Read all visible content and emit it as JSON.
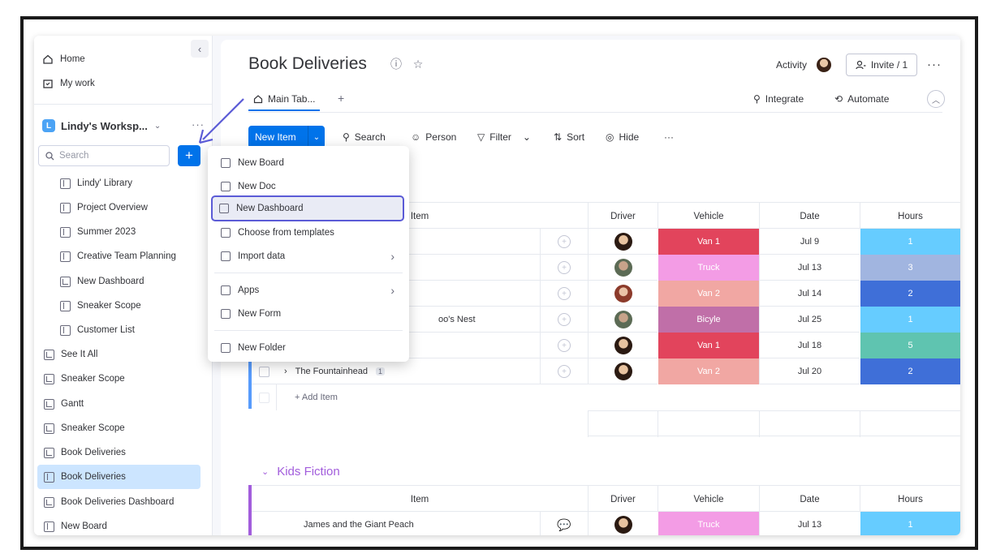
{
  "sidebar": {
    "collapse_icon": "chevron-left-icon",
    "nav": [
      {
        "label": "Home",
        "icon": "home-icon"
      },
      {
        "label": "My work",
        "icon": "calendar-icon"
      }
    ],
    "workspace": {
      "badge": "L",
      "name": "Lindy's Worksp...",
      "badge_color": "#4ba3f5"
    },
    "search_placeholder": "Search",
    "add_button_label": "+",
    "items": [
      {
        "label": "Lindy' Library"
      },
      {
        "label": "Project Overview"
      },
      {
        "label": "Summer 2023"
      },
      {
        "label": "Creative Team Planning"
      },
      {
        "label": "New Dashboard"
      },
      {
        "label": "Sneaker Scope"
      },
      {
        "label": "Customer List"
      },
      {
        "label": "See It All"
      },
      {
        "label": "Sneaker Scope"
      },
      {
        "label": "Gantt"
      },
      {
        "label": "Sneaker Scope"
      },
      {
        "label": "Book Deliveries"
      },
      {
        "label": "Book Deliveries",
        "selected": true
      },
      {
        "label": "Book Deliveries Dashboard"
      },
      {
        "label": "New Board"
      }
    ]
  },
  "header": {
    "title": "Book Deliveries",
    "activity_label": "Activity",
    "invite_label": "Invite / 1",
    "tab_main": "Main Tab...",
    "tab_add": "+",
    "integrate_label": "Integrate",
    "automate_label": "Automate"
  },
  "toolbar": {
    "new_item": "New Item",
    "search": "Search",
    "person": "Person",
    "filter": "Filter",
    "sort": "Sort",
    "hide": "Hide"
  },
  "table": {
    "columns": [
      "Item",
      "Driver",
      "Vehicle",
      "Date",
      "Hours"
    ],
    "rows": [
      {
        "item": "",
        "vehicle": "Van 1",
        "vehicle_color": "#e2445c",
        "date": "Jul 9",
        "hours": "1",
        "hours_color": "#66ccff",
        "avatar": "d"
      },
      {
        "item": "",
        "vehicle": "Truck",
        "vehicle_color": "#f39ce5",
        "date": "Jul 13",
        "hours": "3",
        "hours_color": "#a1b5e0",
        "avatar": "g"
      },
      {
        "item": "",
        "vehicle": "Van 2",
        "vehicle_color": "#f1a7a3",
        "date": "Jul 14",
        "hours": "2",
        "hours_color": "#3f6fd8",
        "avatar": "r"
      },
      {
        "item": "oo's Nest",
        "vehicle": "Bicyle",
        "vehicle_color": "#c06fa8",
        "date": "Jul 25",
        "hours": "1",
        "hours_color": "#66ccff",
        "avatar": "g"
      },
      {
        "item": "",
        "vehicle": "Van 1",
        "vehicle_color": "#e2445c",
        "date": "Jul 18",
        "hours": "5",
        "hours_color": "#5fc4b0",
        "avatar": "d"
      },
      {
        "item": "The Fountainhead",
        "vehicle": "Van 2",
        "vehicle_color": "#f1a7a3",
        "date": "Jul 20",
        "hours": "2",
        "hours_color": "#3f6fd8",
        "avatar": "d"
      }
    ],
    "add_item": "+ Add Item",
    "badge": "1"
  },
  "group2": {
    "title": "Kids Fiction",
    "columns": [
      "Item",
      "Driver",
      "Vehicle",
      "Date",
      "Hours"
    ],
    "row": {
      "item": "James and the Giant Peach",
      "vehicle": "Truck",
      "vehicle_color": "#f39ce5",
      "date": "Jul 13",
      "hours": "1",
      "hours_color": "#66ccff"
    }
  },
  "dropdown": {
    "items": [
      {
        "label": "New Board",
        "icon": "board-icon"
      },
      {
        "label": "New Doc",
        "icon": "doc-icon"
      },
      {
        "label": "New Dashboard",
        "icon": "dashboard-icon",
        "active": true
      },
      {
        "label": "Choose from templates",
        "icon": "template-icon"
      },
      {
        "label": "Import data",
        "icon": "import-icon",
        "submenu": true
      },
      {
        "label": "Apps",
        "icon": "apps-icon",
        "submenu": true
      },
      {
        "label": "New Form",
        "icon": "form-icon"
      },
      {
        "label": "New Folder",
        "icon": "folder-icon"
      }
    ]
  },
  "colors": {
    "accent": "#0073ea",
    "highlight": "#5b5bd6",
    "group1": "#579bfc",
    "group2": "#a25ddc"
  }
}
